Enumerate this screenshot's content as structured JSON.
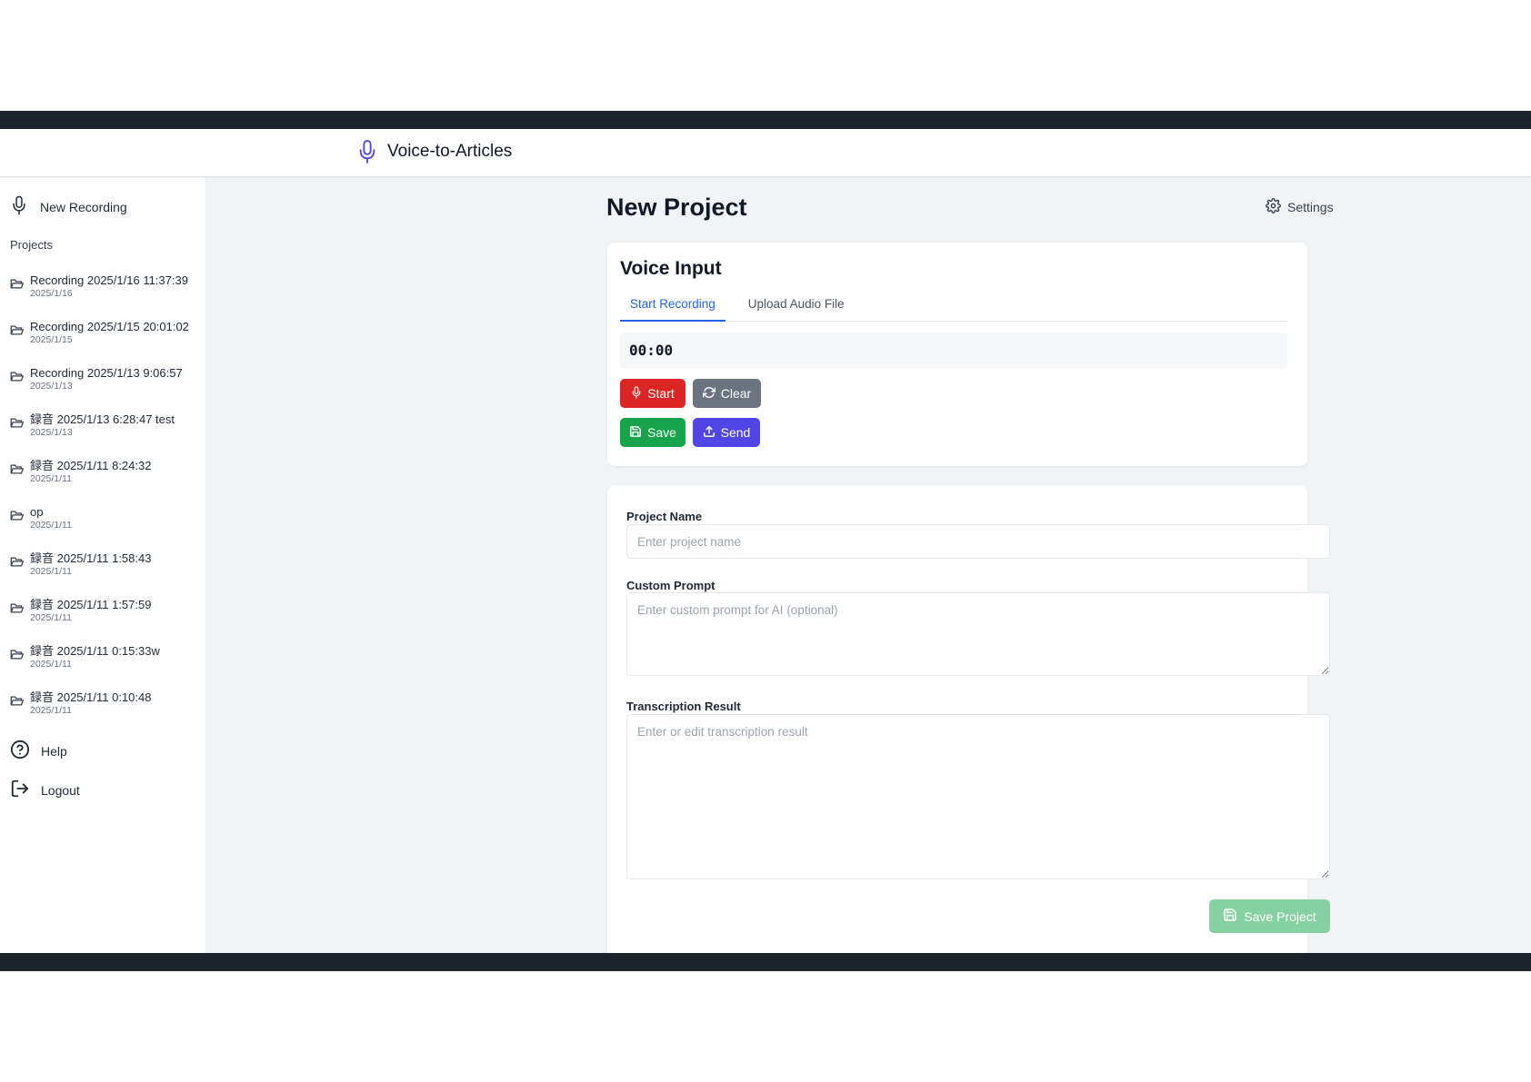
{
  "app": {
    "title": "Voice-to-Articles"
  },
  "sidebar": {
    "new_recording": "New Recording",
    "projects_label": "Projects",
    "projects": [
      {
        "name": "Recording 2025/1/16 11:37:39",
        "date": "2025/1/16"
      },
      {
        "name": "Recording 2025/1/15 20:01:02",
        "date": "2025/1/15"
      },
      {
        "name": "Recording 2025/1/13 9:06:57",
        "date": "2025/1/13"
      },
      {
        "name": "録音 2025/1/13 6:28:47 test",
        "date": "2025/1/13"
      },
      {
        "name": "録音 2025/1/11 8:24:32",
        "date": "2025/1/11"
      },
      {
        "name": "op",
        "date": "2025/1/11"
      },
      {
        "name": "録音 2025/1/11 1:58:43",
        "date": "2025/1/11"
      },
      {
        "name": "録音 2025/1/11 1:57:59",
        "date": "2025/1/11"
      },
      {
        "name": "録音 2025/1/11 0:15:33w",
        "date": "2025/1/11"
      },
      {
        "name": "録音 2025/1/11 0:10:48",
        "date": "2025/1/11"
      }
    ],
    "help": "Help",
    "logout": "Logout"
  },
  "main": {
    "page_title": "New Project",
    "settings_label": "Settings",
    "voice_input": {
      "title": "Voice Input",
      "tabs": [
        {
          "label": "Start Recording",
          "active": true
        },
        {
          "label": "Upload Audio File",
          "active": false
        }
      ],
      "timer": "00:00",
      "buttons": {
        "start": "Start",
        "clear": "Clear",
        "save": "Save",
        "send": "Send"
      }
    },
    "form": {
      "project_name_label": "Project Name",
      "project_name_placeholder": "Enter project name",
      "project_name_value": "",
      "custom_prompt_label": "Custom Prompt",
      "custom_prompt_placeholder": "Enter custom prompt for AI (optional)",
      "custom_prompt_value": "",
      "transcription_label": "Transcription Result",
      "transcription_placeholder": "Enter or edit transcription result",
      "transcription_value": "",
      "save_project": "Save Project"
    }
  },
  "colors": {
    "accent": "#4f46e5",
    "start": "#dc2626",
    "clear": "#6b7280",
    "save": "#16a34a",
    "send": "#4f46e5",
    "save_project_disabled": "#86d1a1",
    "tab_active": "#2563eb",
    "frame_bar": "#1c232b",
    "main_bg": "#f1f4f7"
  },
  "icons": {
    "brand": "microphone-icon",
    "new_recording": "microphone-icon",
    "project": "folder-open-icon",
    "help": "help-circle-icon",
    "logout": "logout-icon",
    "settings": "gear-icon",
    "start": "microphone-icon",
    "clear": "refresh-icon",
    "save": "save-icon",
    "send": "upload-icon",
    "save_project": "save-icon"
  }
}
